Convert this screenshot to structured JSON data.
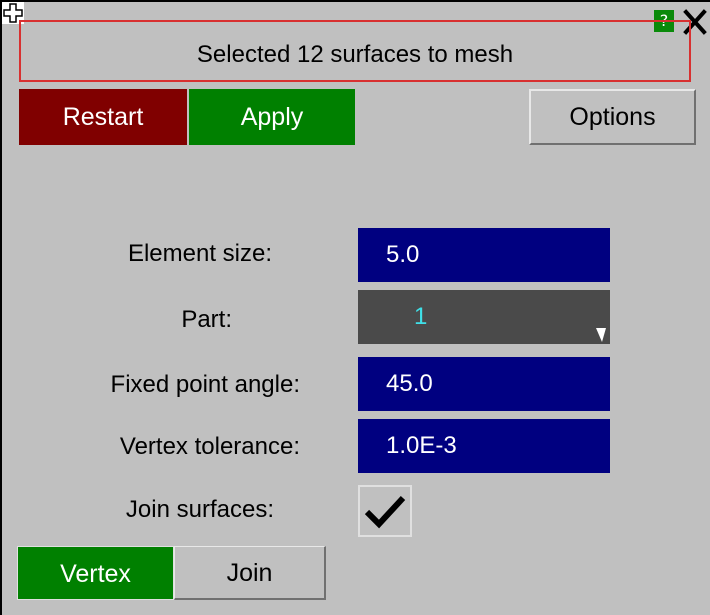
{
  "window": {
    "title": "Selected 12 surfaces to mesh",
    "help_label": "?"
  },
  "toolbar": {
    "restart_label": "Restart",
    "apply_label": "Apply",
    "options_label": "Options"
  },
  "form": {
    "element_size": {
      "label": "Element size:",
      "value": "5.0"
    },
    "part": {
      "label": "Part:",
      "value": "1"
    },
    "fixed_point_angle": {
      "label": "Fixed point angle:",
      "value": "45.0"
    },
    "vertex_tolerance": {
      "label": "Vertex tolerance:",
      "value": "1.0E-3"
    },
    "join_surfaces": {
      "label": "Join surfaces:",
      "checked": true
    }
  },
  "mode_toggle": {
    "vertex_label": "Vertex",
    "join_label": "Join",
    "selected": "Vertex"
  },
  "colors": {
    "background": "#c0c0c0",
    "restart": "#800000",
    "apply": "#008000",
    "field": "#000080",
    "title_border": "#d83030"
  },
  "icons": [
    "move-icon",
    "help-icon",
    "close-icon",
    "dropdown-arrow-icon",
    "checkmark-icon"
  ]
}
